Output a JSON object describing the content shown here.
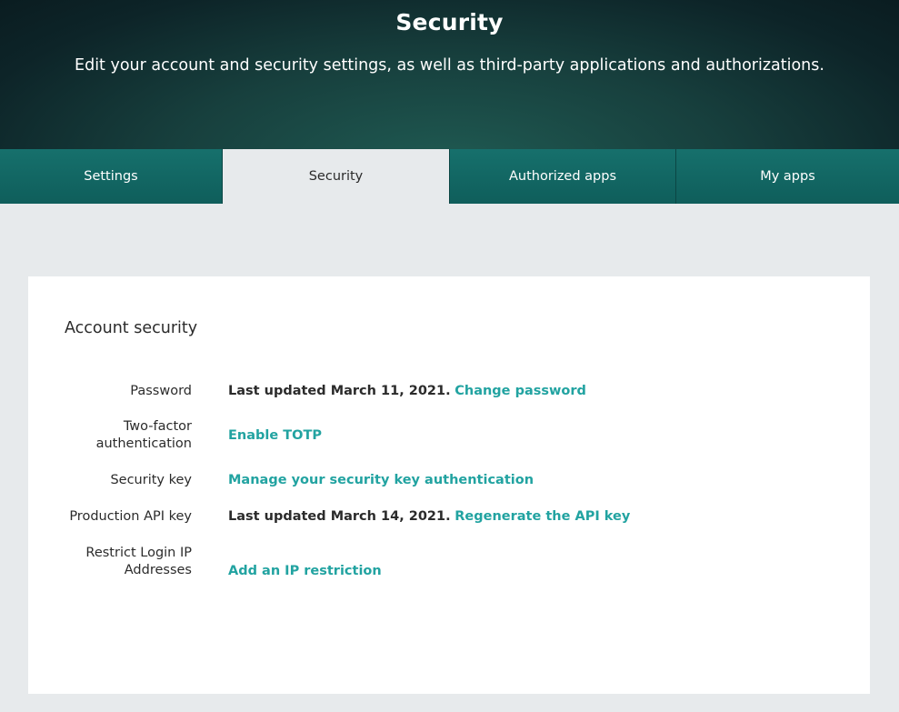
{
  "header": {
    "title": "Security",
    "subtitle": "Edit your account and security settings, as well as third-party applications and authorizations."
  },
  "tabs": [
    {
      "label": "Settings",
      "active": false
    },
    {
      "label": "Security",
      "active": true
    },
    {
      "label": "Authorized apps",
      "active": false
    },
    {
      "label": "My apps",
      "active": false
    }
  ],
  "account_security": {
    "title": "Account security",
    "rows": [
      {
        "label": "Password",
        "static": "Last updated March 11, 2021.",
        "link": "Change password"
      },
      {
        "label": "Two-factor authentication",
        "static": "",
        "link": "Enable TOTP"
      },
      {
        "label": "Security key",
        "static": "",
        "link": "Manage your security key authentication"
      },
      {
        "label": "Production API key",
        "static": "Last updated March 14, 2021.",
        "link": "Regenerate the API key"
      },
      {
        "label": "Restrict Login IP Addresses",
        "static": "",
        "link": "Add an IP restriction"
      }
    ]
  },
  "colors": {
    "accent": "#22a3a1",
    "tab_bg": "#16706c",
    "page_bg": "#e7eaec"
  }
}
